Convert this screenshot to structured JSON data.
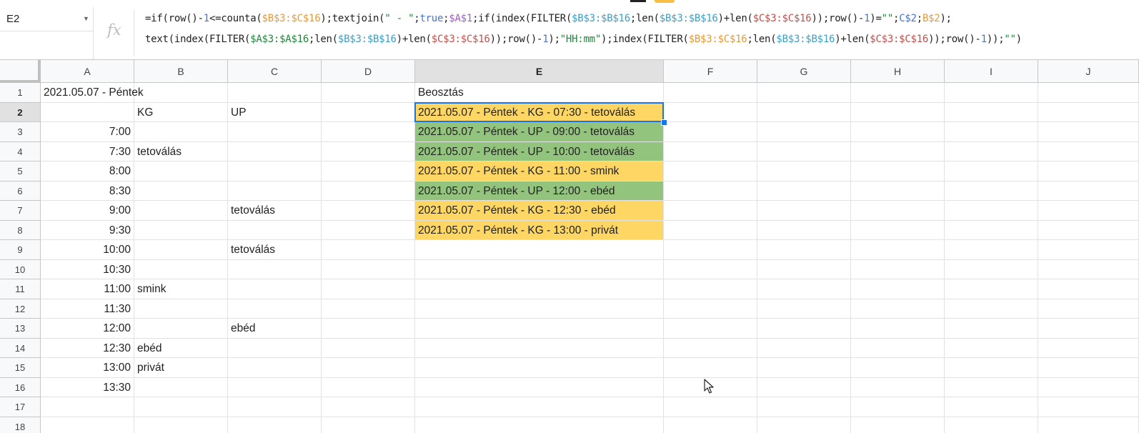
{
  "name_box": {
    "ref": "E2"
  },
  "formula": {
    "fx_label": "fx",
    "line1": [
      {
        "t": "=if(row()-",
        "c": ""
      },
      {
        "t": "1",
        "c": "n"
      },
      {
        "t": "<=counta(",
        "c": ""
      },
      {
        "t": "$B$3:$C$16",
        "c": "o"
      },
      {
        "t": ");textjoin(",
        "c": ""
      },
      {
        "t": "\" - \"",
        "c": "g"
      },
      {
        "t": ";",
        "c": ""
      },
      {
        "t": "true",
        "c": "n"
      },
      {
        "t": ";",
        "c": ""
      },
      {
        "t": "$A$1",
        "c": "p"
      },
      {
        "t": ";if(index(FILTER(",
        "c": ""
      },
      {
        "t": "$B$3:$B$16",
        "c": "b"
      },
      {
        "t": ";len(",
        "c": ""
      },
      {
        "t": "$B$3:$B$16",
        "c": "b"
      },
      {
        "t": ")+len(",
        "c": ""
      },
      {
        "t": "$C$3:$C$16",
        "c": "r"
      },
      {
        "t": "));row()-",
        "c": ""
      },
      {
        "t": "1",
        "c": "n"
      },
      {
        "t": ")=",
        "c": ""
      },
      {
        "t": "\"\"",
        "c": "g"
      },
      {
        "t": ";",
        "c": ""
      },
      {
        "t": "C$2",
        "c": "n"
      },
      {
        "t": ";",
        "c": ""
      },
      {
        "t": "B$2",
        "c": "o"
      },
      {
        "t": ");",
        "c": ""
      }
    ],
    "line2": [
      {
        "t": "text(index(FILTER(",
        "c": ""
      },
      {
        "t": "$A$3:$A$16",
        "c": "g"
      },
      {
        "t": ";len(",
        "c": ""
      },
      {
        "t": "$B$3:$B$16",
        "c": "b"
      },
      {
        "t": ")+len(",
        "c": ""
      },
      {
        "t": "$C$3:$C$16",
        "c": "r"
      },
      {
        "t": "));row()-",
        "c": ""
      },
      {
        "t": "1",
        "c": "n"
      },
      {
        "t": ");",
        "c": ""
      },
      {
        "t": "\"HH:mm\"",
        "c": "g"
      },
      {
        "t": ");index(FILTER(",
        "c": ""
      },
      {
        "t": "$B$3:$C$16",
        "c": "o"
      },
      {
        "t": ";len(",
        "c": ""
      },
      {
        "t": "$B$3:$B$16",
        "c": "b"
      },
      {
        "t": ")+len(",
        "c": ""
      },
      {
        "t": "$C$3:$C$16",
        "c": "r"
      },
      {
        "t": "));row()-",
        "c": ""
      },
      {
        "t": "1",
        "c": "n"
      },
      {
        "t": "));",
        "c": ""
      },
      {
        "t": "\"\"",
        "c": "g"
      },
      {
        "t": ")",
        "c": ""
      }
    ]
  },
  "columns": [
    "A",
    "B",
    "C",
    "D",
    "E",
    "F",
    "G",
    "H",
    "I",
    "J"
  ],
  "selected_column": "E",
  "selected_row": 2,
  "rows": [
    {
      "n": 1,
      "A": "2021.05.07 - Péntek",
      "B": "",
      "C": "",
      "E": "Beosztás",
      "fill": ""
    },
    {
      "n": 2,
      "A": "",
      "B": "KG",
      "C": "UP",
      "E": "2021.05.07 - Péntek - KG - 07:30 - tetoválás",
      "fill": "yellow"
    },
    {
      "n": 3,
      "A": "7:00",
      "B": "",
      "C": "",
      "E": "2021.05.07 - Péntek - UP - 09:00 - tetoválás",
      "fill": "green"
    },
    {
      "n": 4,
      "A": "7:30",
      "B": "tetoválás",
      "C": "",
      "E": "2021.05.07 - Péntek - UP - 10:00 - tetoválás",
      "fill": "green"
    },
    {
      "n": 5,
      "A": "8:00",
      "B": "",
      "C": "",
      "E": "2021.05.07 - Péntek - KG - 11:00 - smink",
      "fill": "yellow"
    },
    {
      "n": 6,
      "A": "8:30",
      "B": "",
      "C": "",
      "E": "2021.05.07 - Péntek - UP - 12:00 - ebéd",
      "fill": "green"
    },
    {
      "n": 7,
      "A": "9:00",
      "B": "",
      "C": "tetoválás",
      "E": "2021.05.07 - Péntek - KG - 12:30 - ebéd",
      "fill": "yellow"
    },
    {
      "n": 8,
      "A": "9:30",
      "B": "",
      "C": "",
      "E": "2021.05.07 - Péntek - KG - 13:00 - privát",
      "fill": "yellow"
    },
    {
      "n": 9,
      "A": "10:00",
      "B": "",
      "C": "tetoválás",
      "E": "",
      "fill": ""
    },
    {
      "n": 10,
      "A": "10:30",
      "B": "",
      "C": "",
      "E": "",
      "fill": ""
    },
    {
      "n": 11,
      "A": "11:00",
      "B": "smink",
      "C": "",
      "E": "",
      "fill": ""
    },
    {
      "n": 12,
      "A": "11:30",
      "B": "",
      "C": "",
      "E": "",
      "fill": ""
    },
    {
      "n": 13,
      "A": "12:00",
      "B": "",
      "C": "ebéd",
      "E": "",
      "fill": ""
    },
    {
      "n": 14,
      "A": "12:30",
      "B": "ebéd",
      "C": "",
      "E": "",
      "fill": ""
    },
    {
      "n": 15,
      "A": "13:00",
      "B": "privát",
      "C": "",
      "E": "",
      "fill": ""
    },
    {
      "n": 16,
      "A": "13:30",
      "B": "",
      "C": "",
      "E": "",
      "fill": ""
    },
    {
      "n": 17,
      "A": "",
      "B": "",
      "C": "",
      "E": "",
      "fill": ""
    },
    {
      "n": 18,
      "A": "",
      "B": "",
      "C": "",
      "E": "",
      "fill": ""
    }
  ],
  "icons": {
    "namebox_caret": "chevron-down-icon",
    "cursor": "mouse-pointer-icon"
  },
  "colors": {
    "yellow": "#fdd663",
    "green": "#93c47d",
    "selection": "#1a73e8"
  }
}
